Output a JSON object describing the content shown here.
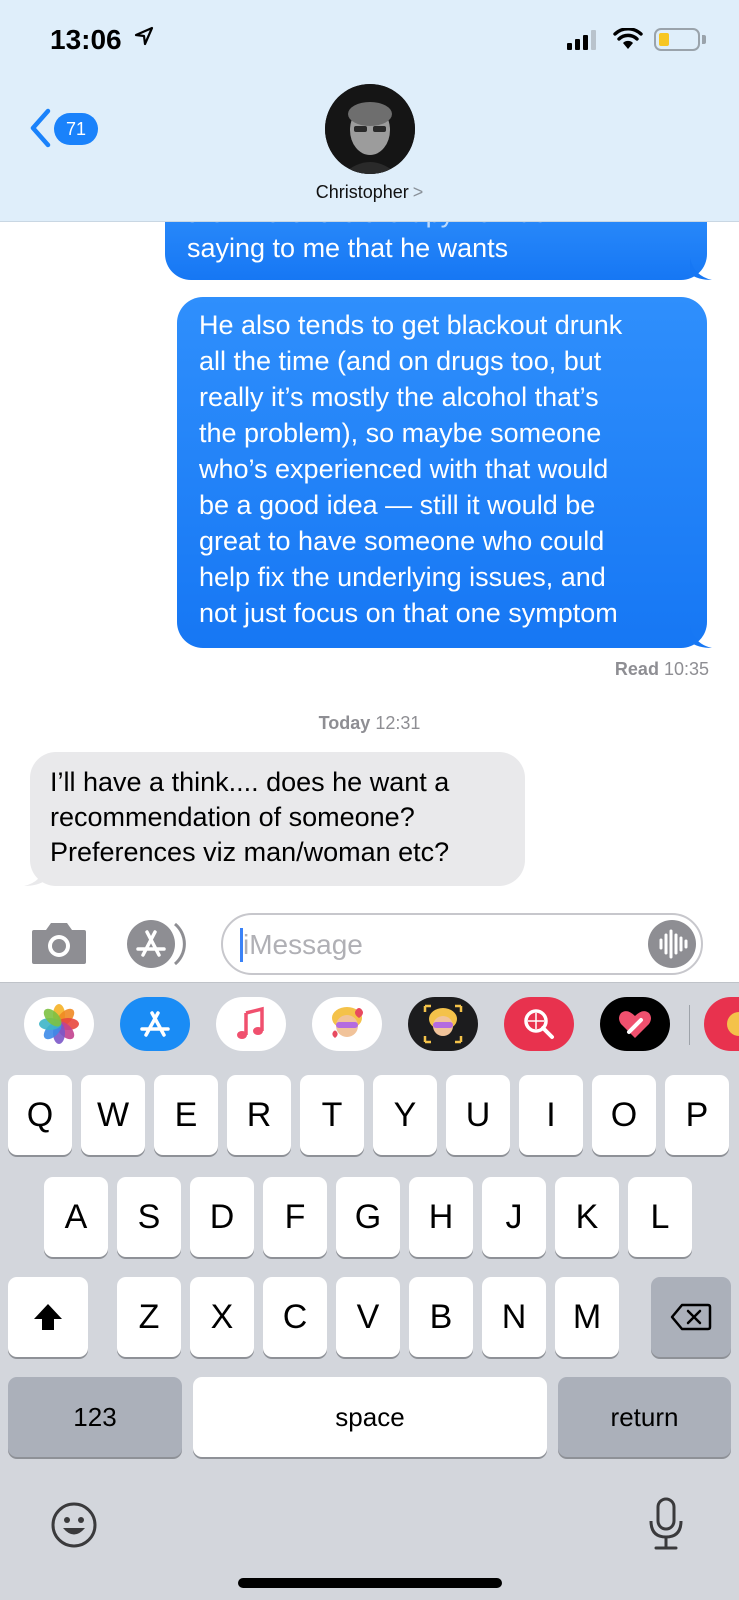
{
  "status_bar": {
    "time": "13:06"
  },
  "header": {
    "back_count": "71",
    "contact_name": "Christopher",
    "contact_chevron": ">"
  },
  "conversation": {
    "msg1_clipped": "the kind of the therapy he was",
    "msg1_visible": "saying to me that he wants",
    "msg2_lines": [
      "He also tends to get blackout drunk",
      "all the time (and on drugs too, but",
      "really it’s mostly the alcohol that’s",
      "the problem), so maybe someone",
      "who’s experienced with that would",
      "be a good idea — still it would be",
      "great to have someone who could",
      "help fix the underlying issues, and",
      "not just focus on that one symptom"
    ],
    "read_label": "Read",
    "read_time": "10:35",
    "timestamp_day": "Today",
    "timestamp_time": "12:31",
    "incoming_lines": [
      "I’ll have a think.... does he want a",
      "recommendation of someone?",
      "Preferences viz man/woman etc?"
    ]
  },
  "input": {
    "placeholder": "iMessage"
  },
  "app_strip": {
    "apps": [
      "photos-app-icon",
      "app-store-icon",
      "music-icon",
      "memoji-stickers-icon",
      "animoji-icon",
      "image-search-icon",
      "digital-touch-icon",
      "more-apps-icon"
    ]
  },
  "keyboard": {
    "row1": [
      "Q",
      "W",
      "E",
      "R",
      "T",
      "Y",
      "U",
      "I",
      "O",
      "P"
    ],
    "row2": [
      "A",
      "S",
      "D",
      "F",
      "G",
      "H",
      "J",
      "K",
      "L"
    ],
    "row3": [
      "Z",
      "X",
      "C",
      "V",
      "B",
      "N",
      "M"
    ],
    "numbers_label": "123",
    "space_label": "space",
    "return_label": "return"
  },
  "colors": {
    "accent": "#1a82fb",
    "outgoing_bubble": "#2385fa",
    "incoming_bubble": "#e9e9eb",
    "keyboard_bg": "#d3d6dc"
  }
}
